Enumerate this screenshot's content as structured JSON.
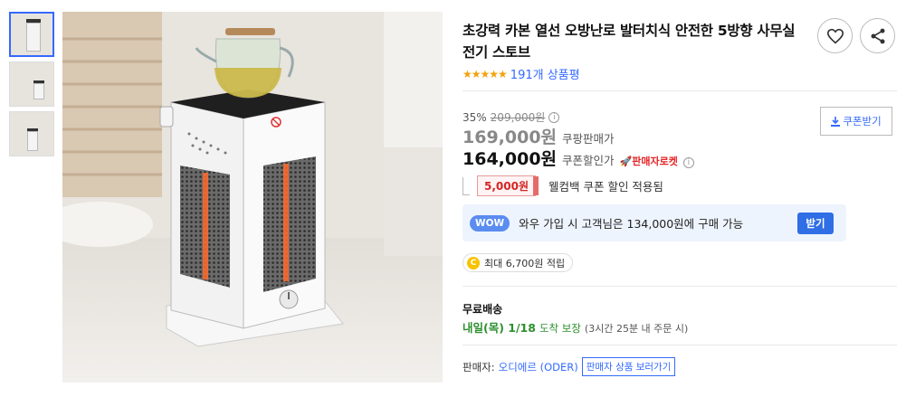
{
  "product": {
    "title": "초강력 카본 열선 오방난로 발터치식 안전한 5방향 사무실 전기 스토브",
    "stars": "★★★★★",
    "review_count": "191개 상품평"
  },
  "actions": {
    "wishlist_icon": "heart-icon",
    "share_icon": "share-icon"
  },
  "price": {
    "discount_rate": "35%",
    "original_price": "209,000원",
    "info_mark": "i",
    "sale_price": "169,000원",
    "sale_label": "쿠팡판매가",
    "coupon_price": "164,000원",
    "coupon_label": "쿠폰할인가",
    "rocket_label": "🚀판매자로켓",
    "coupon_button": "쿠폰받기"
  },
  "welcome": {
    "tag": "5,000원",
    "text": "웰컴백 쿠폰 할인 적용됨"
  },
  "wow": {
    "badge": "WOW",
    "text": "와우 가입 시 고객님은 134,000원에 구매 가능",
    "button": "받기"
  },
  "cash": {
    "coin": "C",
    "text": "최대 6,700원 적립"
  },
  "shipping": {
    "title": "무료배송",
    "date": "내일(목) 1/18",
    "note": "도착 보장",
    "cutoff": "(3시간 25분 내 주문 시)"
  },
  "seller": {
    "label": "판매자:",
    "name": "오디에르 (ODER)",
    "button": "판매자 상품 보러가기"
  },
  "colors": {
    "accent": "#346aff",
    "star": "#f2a20c",
    "rocket": "#e52528",
    "ship": "#2d8f2d"
  }
}
